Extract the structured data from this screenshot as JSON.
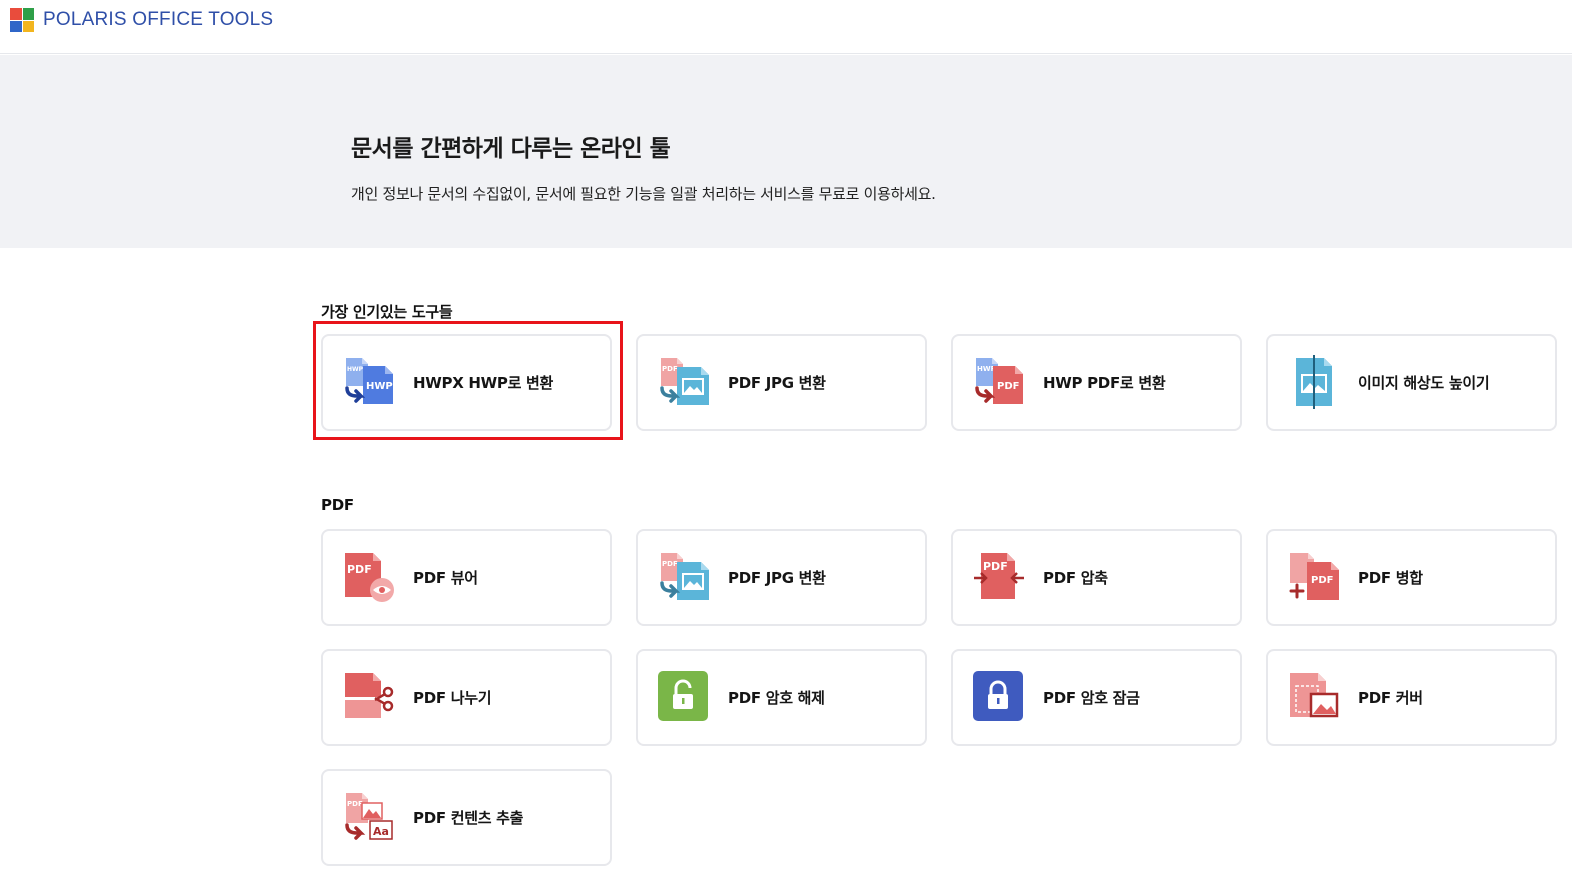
{
  "brand": {
    "name": "POLARIS OFFICE TOOLS",
    "logo_colors": [
      "#e94c3c",
      "#2e9f48",
      "#2f66c8",
      "#f2b51e"
    ]
  },
  "hero": {
    "title": "문서를 간편하게 다루는 온라인 툴",
    "subtitle": "개인 정보나 문서의 수집없이, 문서에 필요한 기능을 일괄 처리하는 서비스를 무료로 이용하세요."
  },
  "sections": {
    "popular": {
      "title": "가장 인기있는 도구들",
      "items": [
        {
          "label": "HWPX HWP로 변환",
          "icon": "hwpx-to-hwp-icon",
          "highlighted": true
        },
        {
          "label": "PDF JPG 변환",
          "icon": "pdf-to-jpg-icon"
        },
        {
          "label": "HWP PDF로 변환",
          "icon": "hwp-to-pdf-icon"
        },
        {
          "label": "이미지 해상도 높이기",
          "icon": "image-upscale-icon"
        }
      ]
    },
    "pdf": {
      "title": "PDF",
      "items": [
        {
          "label": "PDF 뷰어",
          "icon": "pdf-viewer-icon"
        },
        {
          "label": "PDF JPG 변환",
          "icon": "pdf-to-jpg-icon"
        },
        {
          "label": "PDF 압축",
          "icon": "pdf-compress-icon"
        },
        {
          "label": "PDF 병합",
          "icon": "pdf-merge-icon"
        },
        {
          "label": "PDF 나누기",
          "icon": "pdf-split-icon"
        },
        {
          "label": "PDF 암호 해제",
          "icon": "pdf-unlock-icon"
        },
        {
          "label": "PDF 암호 잠금",
          "icon": "pdf-lock-icon"
        },
        {
          "label": "PDF 커버",
          "icon": "pdf-cover-icon"
        },
        {
          "label": "PDF 컨텐츠 추출",
          "icon": "pdf-extract-content-icon"
        }
      ]
    }
  },
  "icon_text": {
    "hwp": "HWP",
    "pdf": "PDF",
    "aa": "Aa"
  },
  "colors": {
    "highlight": "#e8141a",
    "hwp_blue": "#4f7be0",
    "pdf_red": "#e06060",
    "image_teal": "#5bb5d9",
    "unlock_green": "#7ab648",
    "lock_navy": "#3f5bbf"
  }
}
